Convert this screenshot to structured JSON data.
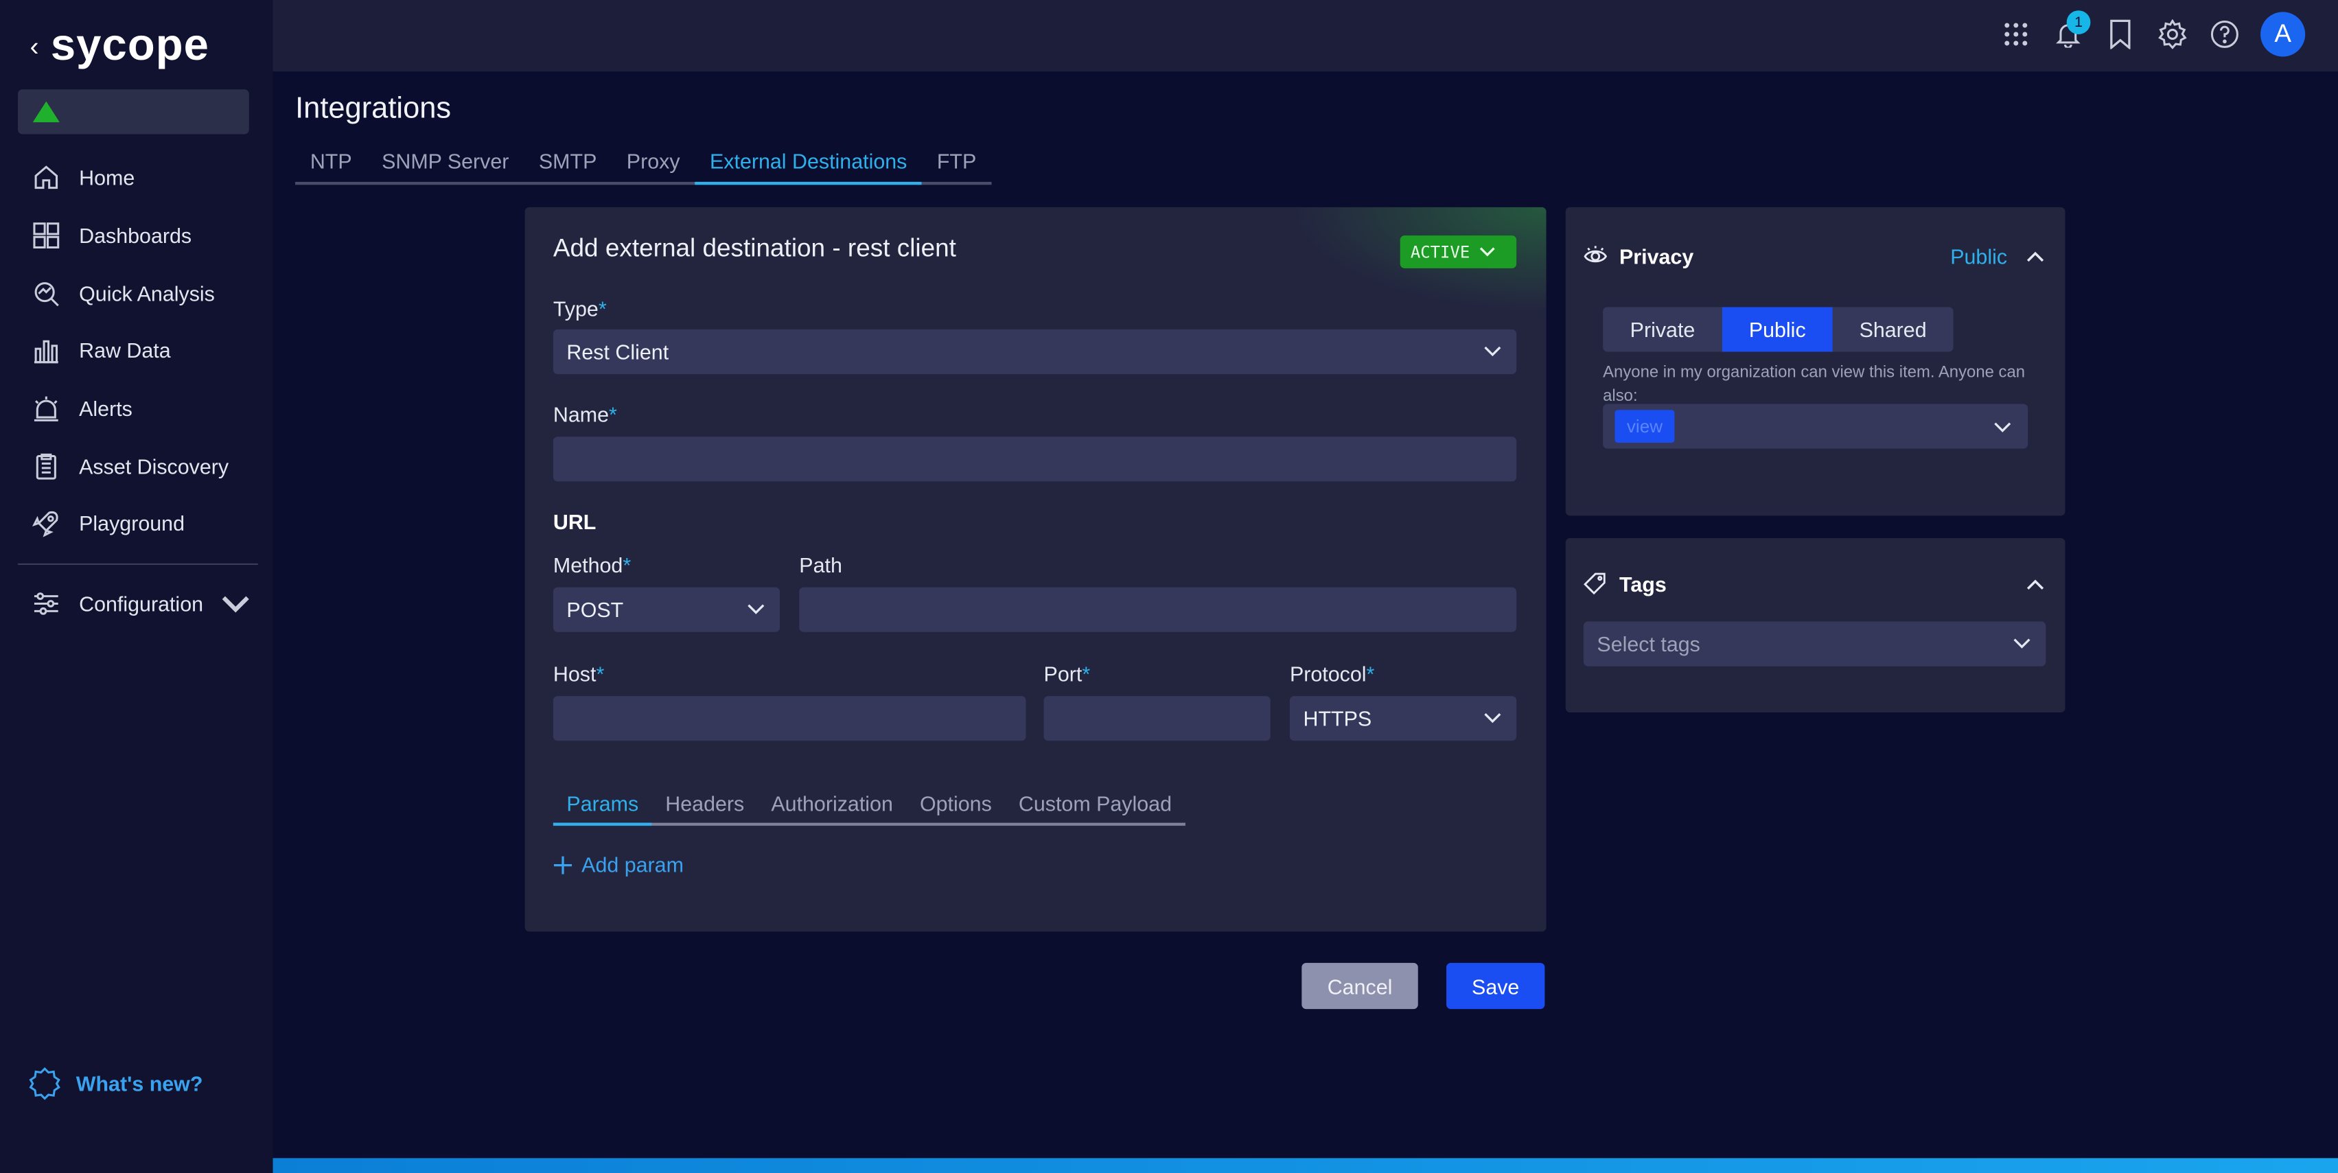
{
  "brand": {
    "name": "sycope",
    "back": "‹"
  },
  "sidebar": {
    "items": [
      {
        "label": "Home",
        "icon": "home-icon"
      },
      {
        "label": "Dashboards",
        "icon": "dashboards-icon"
      },
      {
        "label": "Quick Analysis",
        "icon": "quick-analysis-icon"
      },
      {
        "label": "Raw Data",
        "icon": "raw-data-icon"
      },
      {
        "label": "Alerts",
        "icon": "alerts-icon"
      },
      {
        "label": "Asset Discovery",
        "icon": "asset-discovery-icon"
      },
      {
        "label": "Playground",
        "icon": "playground-icon"
      }
    ],
    "configuration": "Configuration",
    "whats_new": "What's new?"
  },
  "topbar": {
    "notification_count": "1",
    "avatar_letter": "A"
  },
  "page": {
    "title": "Integrations",
    "tabs": [
      "NTP",
      "SNMP Server",
      "SMTP",
      "Proxy",
      "External Destinations",
      "FTP"
    ],
    "active_tab": "External Destinations"
  },
  "form": {
    "title": "Add external destination - rest client",
    "status": "ACTIVE",
    "type_label": "Type",
    "type_value": "Rest Client",
    "name_label": "Name",
    "name_value": "",
    "url_heading": "URL",
    "method_label": "Method",
    "method_value": "POST",
    "path_label": "Path",
    "path_value": "",
    "host_label": "Host",
    "host_value": "",
    "port_label": "Port",
    "port_value": "",
    "protocol_label": "Protocol",
    "protocol_value": "HTTPS",
    "required_marker": "*",
    "subtabs": [
      "Params",
      "Headers",
      "Authorization",
      "Options",
      "Custom Payload"
    ],
    "active_subtab": "Params",
    "add_param": "Add param"
  },
  "actions": {
    "cancel": "Cancel",
    "save": "Save"
  },
  "privacy": {
    "title": "Privacy",
    "current": "Public",
    "options": [
      "Private",
      "Public",
      "Shared"
    ],
    "description": "Anyone in my organization can view this item. Anyone can also:",
    "permission_chip": "view"
  },
  "tags": {
    "title": "Tags",
    "placeholder": "Select tags"
  },
  "colors": {
    "accent": "#2fb0ea",
    "primary": "#1a4df2",
    "active_green": "#1c9c25"
  }
}
